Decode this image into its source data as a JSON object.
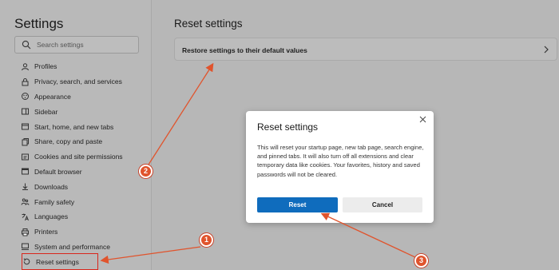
{
  "sidebar": {
    "title": "Settings",
    "search_placeholder": "Search settings",
    "items": [
      {
        "label": "Profiles",
        "icon": "profile-icon"
      },
      {
        "label": "Privacy, search, and services",
        "icon": "lock-icon"
      },
      {
        "label": "Appearance",
        "icon": "appearance-icon"
      },
      {
        "label": "Sidebar",
        "icon": "sidebar-icon"
      },
      {
        "label": "Start, home, and new tabs",
        "icon": "home-icon"
      },
      {
        "label": "Share, copy and paste",
        "icon": "share-icon"
      },
      {
        "label": "Cookies and site permissions",
        "icon": "cookie-icon"
      },
      {
        "label": "Default browser",
        "icon": "browser-icon"
      },
      {
        "label": "Downloads",
        "icon": "download-icon"
      },
      {
        "label": "Family safety",
        "icon": "family-icon"
      },
      {
        "label": "Languages",
        "icon": "language-icon"
      },
      {
        "label": "Printers",
        "icon": "printer-icon"
      },
      {
        "label": "System and performance",
        "icon": "system-icon"
      },
      {
        "label": "Reset settings",
        "icon": "reset-icon"
      }
    ]
  },
  "main": {
    "title": "Reset settings",
    "restore_label": "Restore settings to their default values"
  },
  "dialog": {
    "title": "Reset settings",
    "body": "This will reset your startup page, new tab page, search engine, and pinned tabs. It will also turn off all extensions and clear temporary data like cookies. Your favorites, history and saved passwords will not be cleared.",
    "reset_label": "Reset",
    "cancel_label": "Cancel"
  },
  "annotations": {
    "markers": [
      "1",
      "2",
      "3"
    ],
    "color": "#e0542d"
  },
  "colors": {
    "accent": "#0f6cbd",
    "highlight_box": "#d9261c"
  }
}
